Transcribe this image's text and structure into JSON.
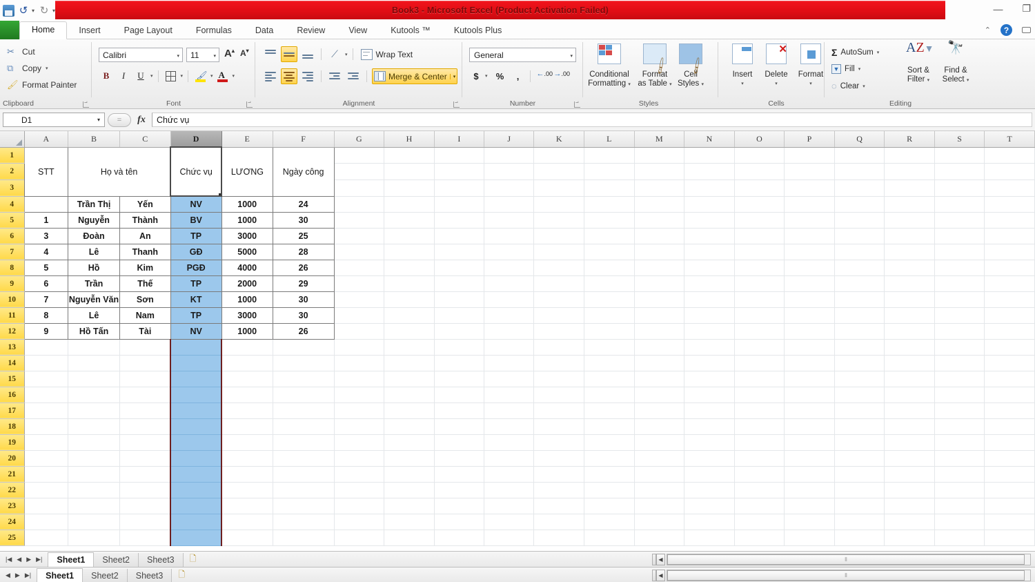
{
  "window": {
    "title": "Book3  -  Microsoft Excel (Product Activation Failed)",
    "minimize": "—",
    "restore": "❐"
  },
  "quick_access": {
    "save": "save-icon",
    "undo": "↺",
    "redo": "↻",
    "customize": "▾"
  },
  "tabs": [
    {
      "label": "Home",
      "active": true
    },
    {
      "label": "Insert",
      "active": false
    },
    {
      "label": "Page Layout",
      "active": false
    },
    {
      "label": "Formulas",
      "active": false
    },
    {
      "label": "Data",
      "active": false
    },
    {
      "label": "Review",
      "active": false
    },
    {
      "label": "View",
      "active": false
    },
    {
      "label": "Kutools ™",
      "active": false
    },
    {
      "label": "Kutools Plus",
      "active": false
    }
  ],
  "tabstrip_right": {
    "collapse": "⌃",
    "help": "?",
    "minimize_ribbon": "▭"
  },
  "ribbon": {
    "clipboard": {
      "caption": "Clipboard",
      "cut": "Cut",
      "copy": "Copy",
      "format_painter": "Format Painter",
      "caret": "▾"
    },
    "font": {
      "caption": "Font",
      "font_name": "Calibri",
      "font_size": "11",
      "grow_font": "A",
      "shrink_font": "A",
      "bold": "B",
      "italic": "I",
      "underline": "U",
      "borders": "borders-icon",
      "fill_color": "fill-color-icon",
      "font_color": "A"
    },
    "alignment": {
      "caption": "Alignment",
      "wrap_text": "Wrap Text",
      "merge_center": "Merge & Center",
      "merge_caret": "▾",
      "orientation": "orientation-icon"
    },
    "number": {
      "caption": "Number",
      "format": "General",
      "currency": "$",
      "percent": "%",
      "comma": ",",
      "increase_decimal": ".00",
      "decrease_decimal": ".00"
    },
    "styles": {
      "caption": "Styles",
      "conditional_formatting": "Conditional\nFormatting",
      "conditional_formatting_l1": "Conditional",
      "conditional_formatting_l2": "Formatting",
      "format_as_table_l1": "Format",
      "format_as_table_l2": "as Table",
      "cell_styles_l1": "Cell",
      "cell_styles_l2": "Styles",
      "caret": "▾"
    },
    "cells": {
      "caption": "Cells",
      "insert": "Insert",
      "delete": "Delete",
      "format": "Format",
      "caret": "▾"
    },
    "editing": {
      "caption": "Editing",
      "autosum": "AutoSum",
      "fill": "Fill",
      "clear": "Clear",
      "sort_filter_l1": "Sort &",
      "sort_filter_l2": "Filter",
      "find_select_l1": "Find &",
      "find_select_l2": "Select",
      "caret": "▾"
    }
  },
  "formula_bar": {
    "name_box": "D1",
    "name_box_arrow": "▾",
    "fx": "fx",
    "formula_value": "Chức vụ",
    "expand": "⌄"
  },
  "grid": {
    "columns": [
      "A",
      "B",
      "C",
      "D",
      "E",
      "F",
      "G",
      "H",
      "I",
      "J",
      "K",
      "L",
      "M",
      "N",
      "O",
      "P",
      "Q",
      "R",
      "S",
      "T"
    ],
    "selected_column": "D",
    "rows": [
      1,
      2,
      3,
      4,
      5,
      6,
      7,
      8,
      9,
      10,
      11,
      12,
      13,
      14,
      15,
      16,
      17,
      18,
      19,
      20,
      21,
      22,
      23,
      24,
      25
    ],
    "headers": {
      "stt": "STT",
      "ho_va_ten": "Họ và tên",
      "chuc_vu": "Chức vụ",
      "luong": "LƯƠNG",
      "ngay_cong": "Ngày công"
    },
    "table_rows": [
      {
        "row": 4,
        "stt": "",
        "ho": "Trần Thị",
        "ten": "Yến",
        "chuc_vu": "NV",
        "luong": "1000",
        "ngay_cong": "24"
      },
      {
        "row": 5,
        "stt": "1",
        "ho": "Nguyễn",
        "ten": "Thành",
        "chuc_vu": "BV",
        "luong": "1000",
        "ngay_cong": "30"
      },
      {
        "row": 6,
        "stt": "3",
        "ho": "Đoàn",
        "ten": "An",
        "chuc_vu": "TP",
        "luong": "3000",
        "ngay_cong": "25"
      },
      {
        "row": 7,
        "stt": "4",
        "ho": "Lê",
        "ten": "Thanh",
        "chuc_vu": "GĐ",
        "luong": "5000",
        "ngay_cong": "28"
      },
      {
        "row": 8,
        "stt": "5",
        "ho": "Hồ",
        "ten": "Kim",
        "chuc_vu": "PGĐ",
        "luong": "4000",
        "ngay_cong": "26"
      },
      {
        "row": 9,
        "stt": "6",
        "ho": "Trần",
        "ten": "Thế",
        "chuc_vu": "TP",
        "luong": "2000",
        "ngay_cong": "29"
      },
      {
        "row": 10,
        "stt": "7",
        "ho": "Nguyễn Văn",
        "ten": "Sơn",
        "chuc_vu": "KT",
        "luong": "1000",
        "ngay_cong": "30"
      },
      {
        "row": 11,
        "stt": "8",
        "ho": "Lê",
        "ten": "Nam",
        "chuc_vu": "TP",
        "luong": "3000",
        "ngay_cong": "30"
      },
      {
        "row": 12,
        "stt": "9",
        "ho": "Hồ Tấn",
        "ten": "Tài",
        "chuc_vu": "NV",
        "luong": "1000",
        "ngay_cong": "26"
      }
    ]
  },
  "status_bar": {
    "nav_first": "|◀",
    "nav_prev": "◀",
    "nav_next": "▶",
    "nav_last": "▶|",
    "sheets": [
      {
        "label": "Sheet1",
        "active": true
      },
      {
        "label": "Sheet2",
        "active": false
      },
      {
        "label": "Sheet3",
        "active": false
      }
    ],
    "new_sheet": "new-sheet-icon",
    "scroll_left": "◀",
    "scroll_thumb": "⦀"
  },
  "colors": {
    "title_red": "#e8121a",
    "selection_blue": "#9cc8ec",
    "row_header_yellow": "#ffd94a",
    "ribbon_highlight": "#ffd24d",
    "file_tab_green": "#1f7a1f"
  }
}
